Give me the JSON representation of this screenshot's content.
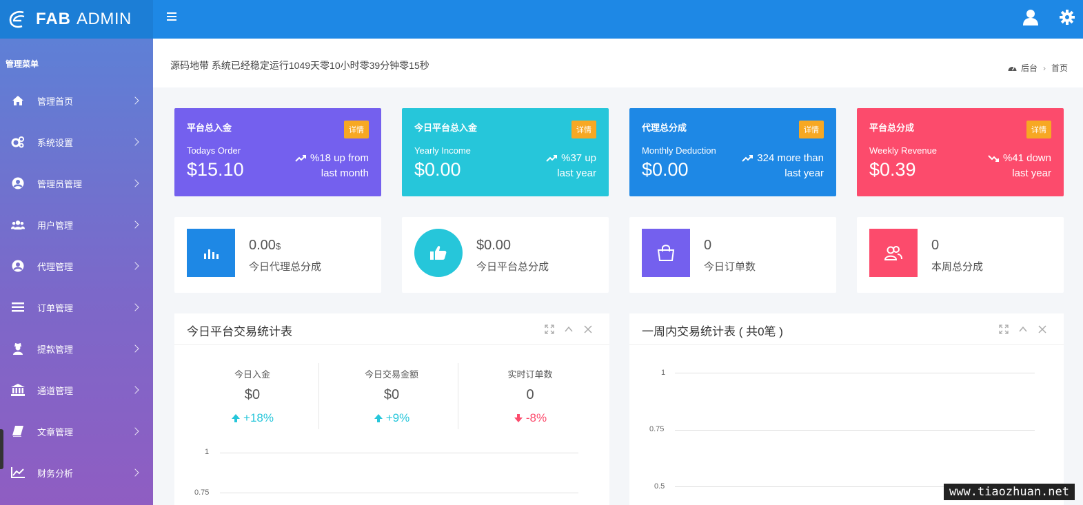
{
  "brand": {
    "bold": "FAB",
    "rest": "ADMIN"
  },
  "sidebar": {
    "title": "管理菜单",
    "items": [
      {
        "label": "管理首页",
        "icon": "home-icon"
      },
      {
        "label": "系统设置",
        "icon": "gears-icon"
      },
      {
        "label": "管理员管理",
        "icon": "user-circle-icon"
      },
      {
        "label": "用户管理",
        "icon": "users-icon"
      },
      {
        "label": "代理管理",
        "icon": "user-circle-icon"
      },
      {
        "label": "订单管理",
        "icon": "list-icon"
      },
      {
        "label": "提款管理",
        "icon": "user-secret-icon"
      },
      {
        "label": "通道管理",
        "icon": "bank-icon"
      },
      {
        "label": "文章管理",
        "icon": "book-icon"
      },
      {
        "label": "财务分析",
        "icon": "line-chart-icon"
      }
    ]
  },
  "header": {
    "uptime": "源码地带 系统已经稳定运行1049天零10小时零39分钟零15秒",
    "breadcrumb": [
      "后台",
      "首页"
    ]
  },
  "stat_cards": [
    {
      "title": "平台总入金",
      "badge": "详情",
      "sub": "Todays Order",
      "value": "$15.10",
      "trend1": "%18 up from",
      "trend2": "last month",
      "color": "#7460ee"
    },
    {
      "title": "今日平台总入金",
      "badge": "详情",
      "sub": "Yearly Income",
      "value": "$0.00",
      "trend1": "%37 up",
      "trend2": "last year",
      "color": "#26c6da"
    },
    {
      "title": "代理总分成",
      "badge": "详情",
      "sub": "Monthly Deduction",
      "value": "$0.00",
      "trend1": "324 more than",
      "trend2": "last year",
      "color": "#1e88e5"
    },
    {
      "title": "平台总分成",
      "badge": "详情",
      "sub": "Weekly Revenue",
      "value": "$0.39",
      "trend1": "%41 down",
      "trend2": "last year",
      "color": "#fc4b6c"
    }
  ],
  "info_cards": [
    {
      "value": "0.00",
      "unit": "$",
      "label": "今日代理总分成",
      "color": "#1e88e5",
      "icon": "bar-chart-icon"
    },
    {
      "value": "$0.00",
      "unit": "",
      "label": "今日平台总分成",
      "color": "#26c6da",
      "icon": "thumbs-up-icon"
    },
    {
      "value": "0",
      "unit": "",
      "label": "今日订单数",
      "color": "#7460ee",
      "icon": "shopping-bag-icon"
    },
    {
      "value": "0",
      "unit": "",
      "label": "本周总分成",
      "color": "#fc4b6c",
      "icon": "users-icon"
    }
  ],
  "panel_today": {
    "title": "今日平台交易统计表",
    "stats": [
      {
        "label": "今日入金",
        "value": "$0",
        "change": "+18%",
        "dir": "up"
      },
      {
        "label": "今日交易金额",
        "value": "$0",
        "change": "+9%",
        "dir": "up"
      },
      {
        "label": "实时订单数",
        "value": "0",
        "change": "-8%",
        "dir": "down"
      }
    ],
    "y_ticks": [
      "1",
      "0.75"
    ]
  },
  "panel_week": {
    "title": "一周内交易统计表 ( 共0笔 )",
    "y_ticks": [
      "1",
      "0.75",
      "0.5"
    ]
  },
  "watermark": "www.tiaozhuan.net"
}
